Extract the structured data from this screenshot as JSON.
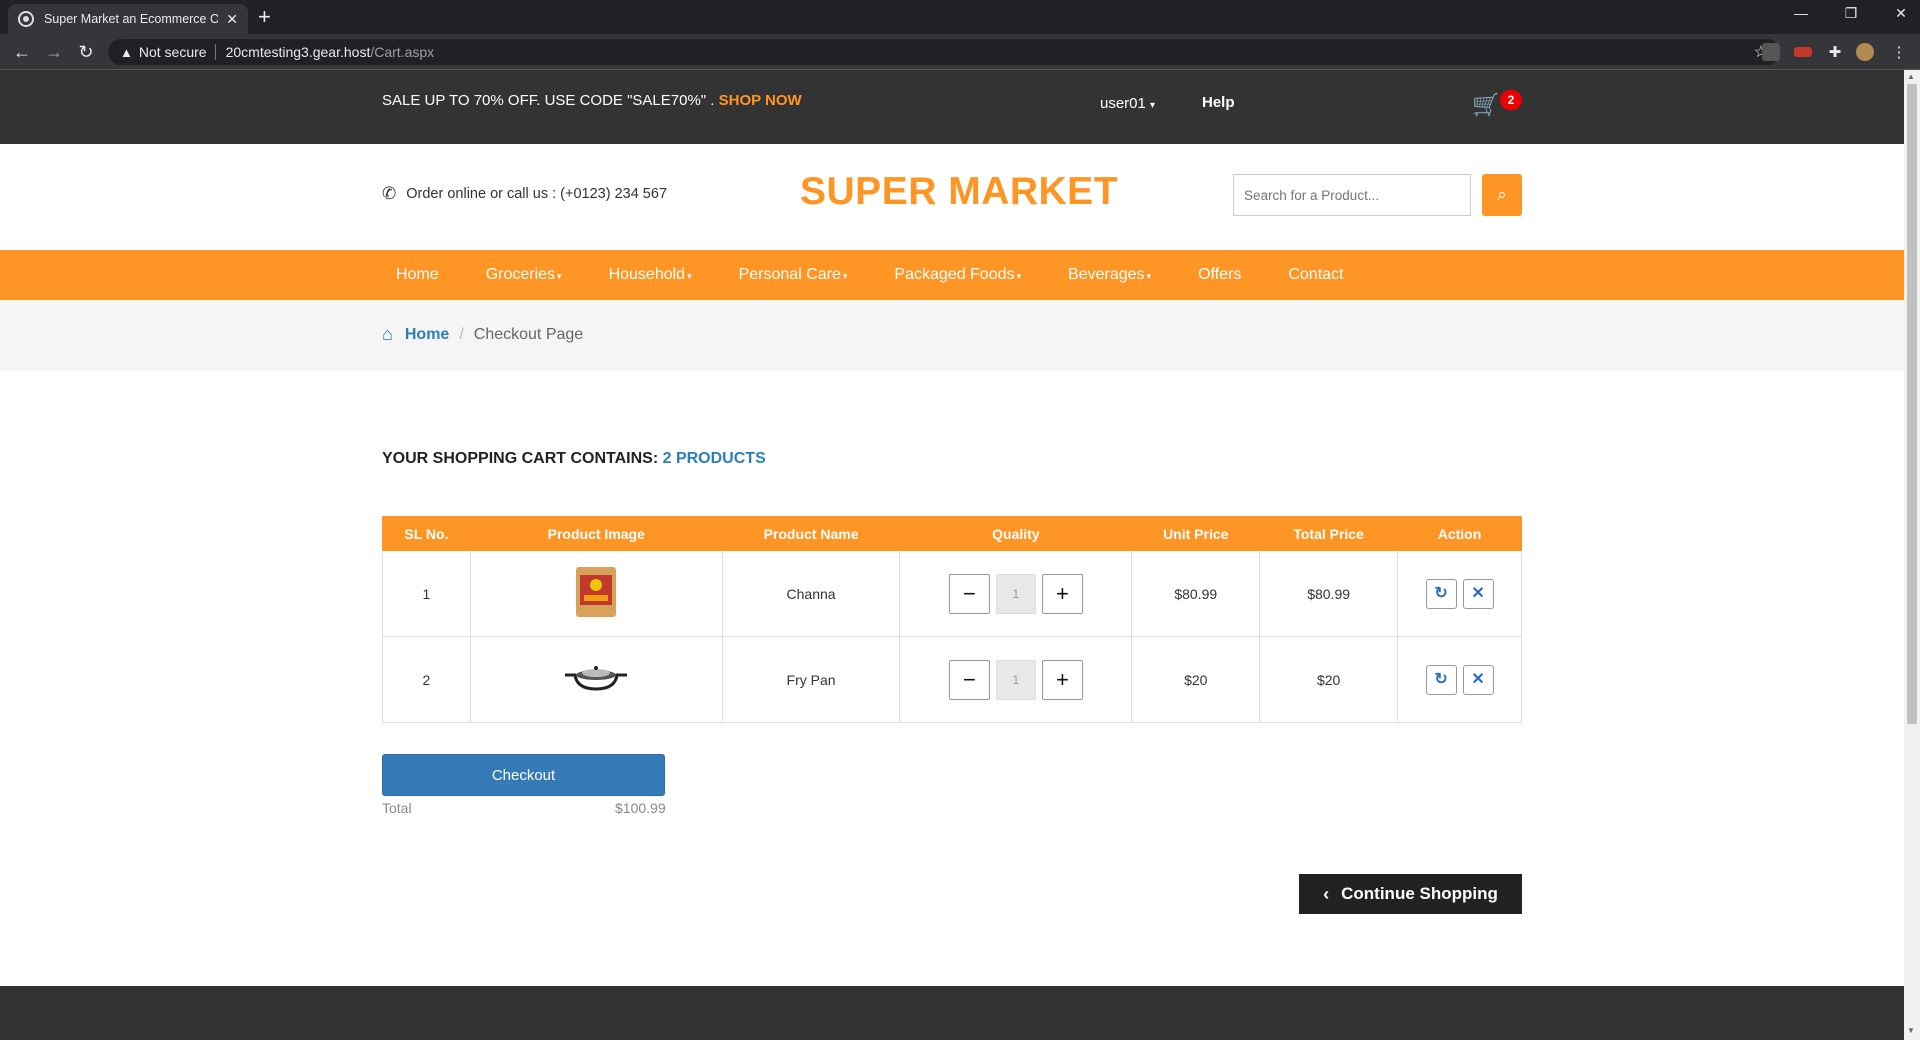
{
  "browser": {
    "tab_title": "Super Market an Ecommerce Onl",
    "not_secure": "Not secure",
    "url_host": "20cmtesting3.gear.host",
    "url_path": "/Cart.aspx"
  },
  "topbar": {
    "promo_text": "SALE UP TO 70% OFF. USE CODE \"SALE70%\" . ",
    "promo_link": "SHOP NOW",
    "user": "user01",
    "help": "Help",
    "cart_count": "2"
  },
  "header": {
    "phone_text": "Order online or call us : (+0123) 234 567",
    "logo": "SUPER MARKET",
    "search_placeholder": "Search for a Product..."
  },
  "nav": {
    "items": [
      "Home",
      "Groceries",
      "Household",
      "Personal Care",
      "Packaged Foods",
      "Beverages",
      "Offers",
      "Contact"
    ]
  },
  "breadcrumb": {
    "home": "Home",
    "current": "Checkout Page"
  },
  "cart": {
    "heading": "YOUR SHOPPING CART CONTAINS: ",
    "count_text": "2 PRODUCTS",
    "columns": [
      "SL No.",
      "Product Image",
      "Product Name",
      "Quality",
      "Unit Price",
      "Total Price",
      "Action"
    ],
    "rows": [
      {
        "sl": "1",
        "name": "Channa",
        "qty": "1",
        "unit": "$80.99",
        "total": "$80.99"
      },
      {
        "sl": "2",
        "name": "Fry Pan",
        "qty": "1",
        "unit": "$20",
        "total": "$20"
      }
    ],
    "checkout": "Checkout",
    "total_label": "Total",
    "total_value": "$100.99",
    "continue": "Continue Shopping"
  },
  "colors": {
    "accent": "#ff9524",
    "link": "#2980b9",
    "checkout": "#337ab7"
  }
}
